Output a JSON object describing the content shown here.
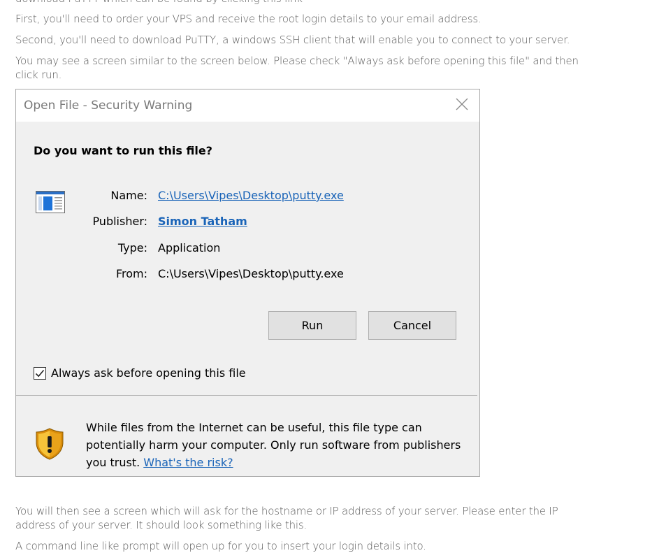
{
  "article": {
    "partial_top_line": "download PuTTY which can be found by clicking this link",
    "para1": "First, you'll need to order your VPS and receive the root login details to your email address.",
    "para2": "Second, you'll need to download PuTTY, a windows SSH client that will enable you to connect to your server.",
    "para3": "You may see a screen similar to the screen below. Please check \"Always ask before opening this file\" and then click run.",
    "para4": "You will then see a screen which will ask for the hostname or IP address of your server. Please enter the IP address of your server. It should look something like this.",
    "para5": "A command line like prompt will open up for you to insert your login details into."
  },
  "dialog": {
    "title": "Open File - Security Warning",
    "question": "Do you want to run this file?",
    "fields": {
      "name_label": "Name:",
      "name_value": "C:\\Users\\Vipes\\Desktop\\putty.exe",
      "publisher_label": "Publisher:",
      "publisher_value": "Simon Tatham",
      "type_label": "Type:",
      "type_value": "Application",
      "from_label": "From:",
      "from_value": "C:\\Users\\Vipes\\Desktop\\putty.exe"
    },
    "buttons": {
      "run": "Run",
      "cancel": "Cancel"
    },
    "checkbox": {
      "label": "Always ask before opening this file",
      "checked": true
    },
    "warning": {
      "text": "While files from the Internet can be useful, this file type can potentially harm your computer. Only run software from publishers you trust. ",
      "link": "What's the risk?"
    },
    "icons": {
      "close": "close-icon",
      "app": "app-window-icon",
      "shield": "shield-warning-icon"
    },
    "colors": {
      "link": "#1a64b8",
      "dialog_bg": "#f0f0f0",
      "shield": "#f2b10f"
    }
  }
}
